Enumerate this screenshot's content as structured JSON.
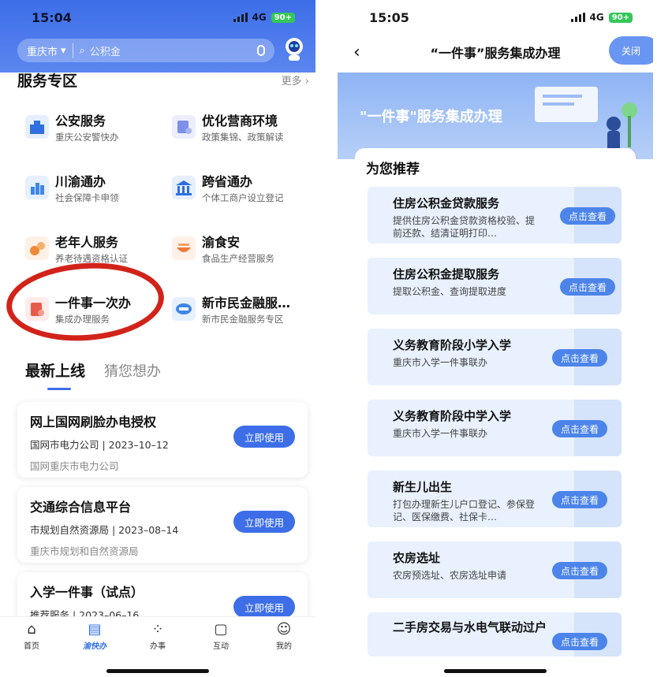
{
  "left": {
    "status": {
      "time": "15:04",
      "network": "4G",
      "battery": "90+"
    },
    "search": {
      "city": "重庆市",
      "placeholder": "公积金"
    },
    "services_section": {
      "title": "服务专区",
      "more": "更多"
    },
    "services": [
      {
        "title": "公安服务",
        "subtitle": "重庆公安警快办",
        "icon": "police-icon",
        "color": "#2f6fe0"
      },
      {
        "title": "优化营商环境",
        "subtitle": "政策集锦、政策解读",
        "icon": "business-icon",
        "color": "#7e8fe8"
      },
      {
        "title": "川渝通办",
        "subtitle": "社会保障卡申领",
        "icon": "city-icon",
        "color": "#3f86e8"
      },
      {
        "title": "跨省通办",
        "subtitle": "个体工商户设立登记",
        "icon": "bank-icon",
        "color": "#2f6fe0"
      },
      {
        "title": "老年人服务",
        "subtitle": "养老待遇资格认证",
        "icon": "elder-icon",
        "color": "#f08a3a"
      },
      {
        "title": "渝食安",
        "subtitle": "食品生产经营服务",
        "icon": "food-icon",
        "color": "#f07a3a"
      },
      {
        "title": "一件事一次办",
        "subtitle": "集成办理服务",
        "icon": "one-thing-icon",
        "color": "#e85b4b"
      },
      {
        "title": "新市民金融服…",
        "subtitle": "新市民金融服务专区",
        "icon": "finance-icon",
        "color": "#3f86e8"
      }
    ],
    "tabs": {
      "active": "最新上线",
      "other": "猜您想办"
    },
    "cards": [
      {
        "title": "网上国网刷脸办电授权",
        "meta": "国网市电力公司 | 2023–10–12",
        "org": "国网重庆市电力公司",
        "button": "立即使用"
      },
      {
        "title": "交通综合信息平台",
        "meta": "市规划自然资源局 | 2023–08–14",
        "org": "重庆市规划和自然资源局",
        "button": "立即使用"
      },
      {
        "title": "入学一件事（试点）",
        "meta": "推荐服务 | 2023–06–16",
        "org": "",
        "button": "立即使用"
      }
    ],
    "tabbar": [
      {
        "label": "首页",
        "icon": "home-icon"
      },
      {
        "label": "渝快办",
        "icon": "yukuaiban-logo"
      },
      {
        "label": "办事",
        "icon": "grid-icon"
      },
      {
        "label": "互动",
        "icon": "chat-icon"
      },
      {
        "label": "我的",
        "icon": "user-icon"
      }
    ]
  },
  "right": {
    "status": {
      "time": "15:05",
      "network": "4G",
      "battery": "90+"
    },
    "nav": {
      "title": "“一件事”服务集成办理",
      "close": "关闭"
    },
    "banner": {
      "title": "\"一件事\"服务集成办理"
    },
    "recommend_title": "为您推荐",
    "items": [
      {
        "title": "住房公积金贷款服务",
        "subtitle": "提供住房公积金贷款资格校验、提前还款、结清证明打印…",
        "button": "点击查看"
      },
      {
        "title": "住房公积金提取服务",
        "subtitle": "提取公积金、查询提取进度",
        "button": "点击查看"
      },
      {
        "title": "义务教育阶段小学入学",
        "subtitle": "重庆市入学一件事联办",
        "button": "点击查看"
      },
      {
        "title": "义务教育阶段中学入学",
        "subtitle": "重庆市入学一件事联办",
        "button": "点击查看"
      },
      {
        "title": "新生儿出生",
        "subtitle": "打包办理新生儿户口登记、参保登记、医保缴费、社保卡…",
        "button": "点击查看"
      },
      {
        "title": "农房选址",
        "subtitle": "农房预选址、农房选址申请",
        "button": "点击查看"
      },
      {
        "title": "二手房交易与水电气联动过户",
        "subtitle": "",
        "button": "点击查看"
      }
    ]
  }
}
